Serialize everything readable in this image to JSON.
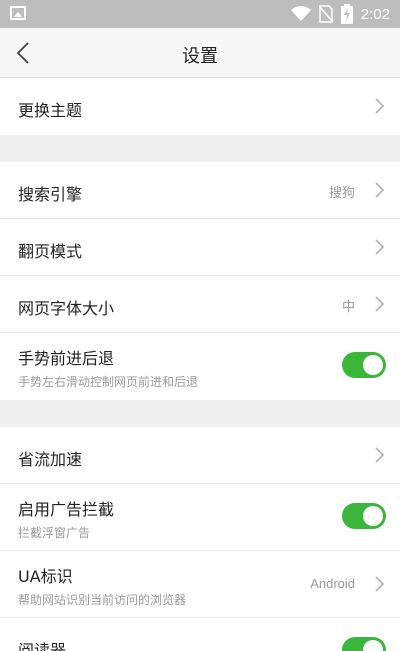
{
  "status_bar": {
    "time": "2:02"
  },
  "header": {
    "title": "设置"
  },
  "groups": [
    [
      {
        "label": "更换主题",
        "type": "nav"
      }
    ],
    [
      {
        "label": "搜索引擎",
        "value": "搜狗",
        "type": "nav"
      },
      {
        "label": "翻页模式",
        "type": "nav"
      },
      {
        "label": "网页字体大小",
        "value": "中",
        "type": "nav"
      },
      {
        "label": "手势前进后退",
        "sub": "手势左右滑动控制网页前进和后退",
        "type": "toggle",
        "on": true
      }
    ],
    [
      {
        "label": "省流加速",
        "type": "nav"
      },
      {
        "label": "启用广告拦截",
        "sub": "拦截浮窗广告",
        "type": "toggle",
        "on": true
      },
      {
        "label": "UA标识",
        "sub": "帮助网站识别当前访问的浏览器",
        "value": "Android",
        "type": "nav"
      },
      {
        "label": "阅读器",
        "type": "toggle",
        "on": true
      }
    ]
  ]
}
